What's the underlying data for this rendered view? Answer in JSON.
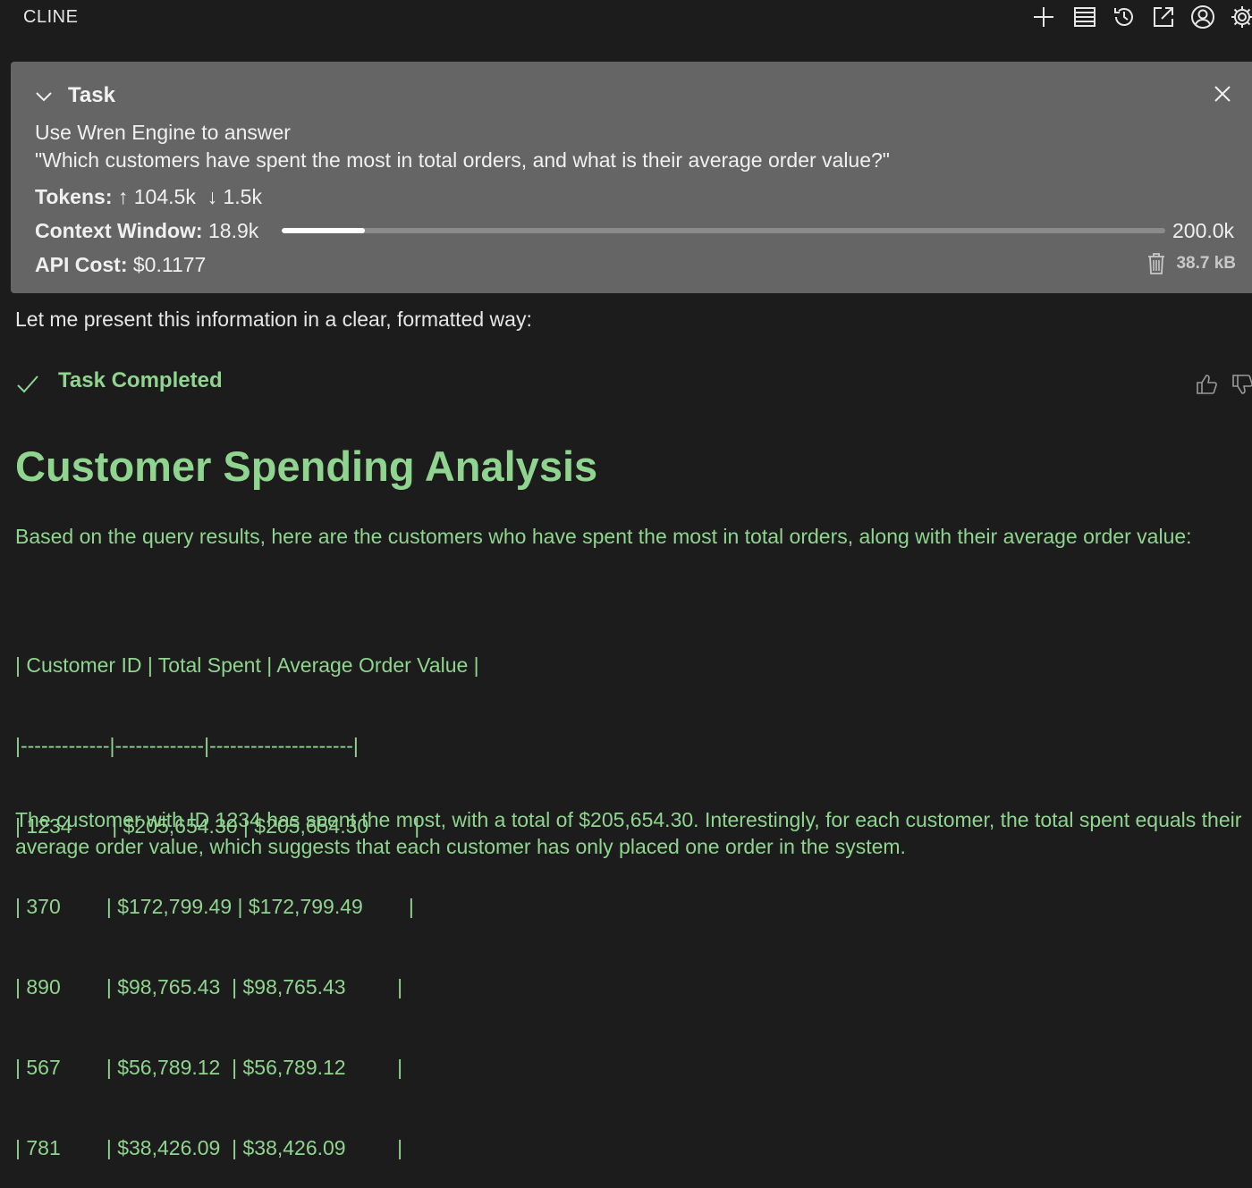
{
  "app": {
    "title": "CLINE"
  },
  "toolbar": {
    "icons": [
      "plus-icon",
      "list-icon",
      "history-icon",
      "popout-icon",
      "account-icon",
      "settings-icon"
    ]
  },
  "task": {
    "title": "Task",
    "text": "Use Wren Engine to answer\n\"Which customers have spent the most in total orders, and what is their average order value?\"",
    "tokens_label": "Tokens:",
    "tokens_in": "104.5k",
    "tokens_out": "1.5k",
    "context_label": "Context Window:",
    "context_used": "18.9k",
    "context_max": "200.0k",
    "context_fraction": 0.0945,
    "cost_label": "API Cost:",
    "cost_value": "$0.1177",
    "size": "38.7 kB"
  },
  "chat": {
    "intro": "Let me present this information in a clear, formatted way:",
    "completed_label": "Task Completed",
    "heading": "Customer Spending Analysis",
    "paragraph1": "Based on the query results, here are the customers who have spent the most in total orders, along with their average order value:",
    "table_lines": [
      "| Customer ID | Total Spent | Average Order Value |",
      "|-------------|-------------|---------------------|",
      "| 1234       | $205,654.30 | $205,654.30        |",
      "| 370        | $172,799.49 | $172,799.49        |",
      "| 890        | $98,765.43  | $98,765.43         |",
      "| 567        | $56,789.12  | $56,789.12         |",
      "| 781        | $38,426.09  | $38,426.09         |"
    ],
    "paragraph2": "The customer with ID 1234 has spent the most, with a total of $205,654.30. Interestingly, for each customer, the total spent equals their average order value, which suggests that each customer has only placed one order in the system."
  },
  "colors": {
    "accent_green": "#8fd48f",
    "panel": "#656565",
    "background": "#1c1c1c"
  }
}
